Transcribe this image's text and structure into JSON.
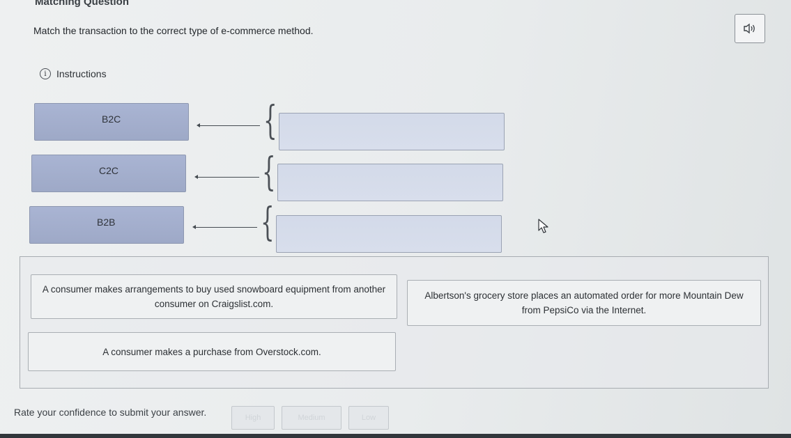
{
  "header": {
    "title": "Matching Question"
  },
  "prompt": "Match the transaction to the correct type of e-commerce method.",
  "instructions": {
    "label": "Instructions",
    "icon": "info-icon"
  },
  "audio": {
    "icon": "speaker-icon"
  },
  "types": [
    {
      "label": "B2C"
    },
    {
      "label": "C2C"
    },
    {
      "label": "B2B"
    }
  ],
  "answers": [
    {
      "text": "A consumer makes arrangements to buy used snowboard equipment from another consumer on Craigslist.com."
    },
    {
      "text": "Albertson's grocery store places an automated order for more Mountain Dew from PepsiCo via the Internet."
    },
    {
      "text": "A consumer makes a purchase from Overstock.com."
    }
  ],
  "confidence": {
    "label": "Rate your confidence to submit your answer.",
    "options": [
      "High",
      "Medium",
      "Low"
    ]
  },
  "colors": {
    "type_card": "#a9b4d3",
    "drop_zone": "#d3dae9",
    "answer_card": "#eff1f2"
  }
}
